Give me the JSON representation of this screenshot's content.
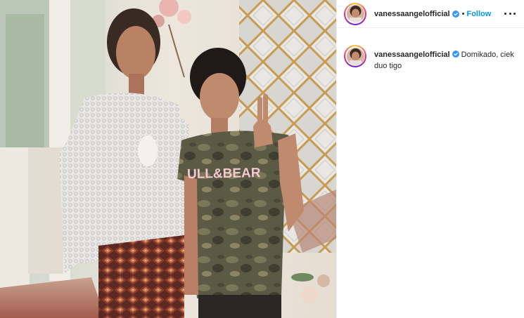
{
  "post": {
    "photo": {
      "subject": "two-women-photo",
      "shirt_print": "ULL&BEAR"
    },
    "header": {
      "username": "vanessaangelofficial",
      "separator": "•",
      "follow_label": "Follow",
      "verified_icon": "verified-badge-icon",
      "more_icon": "more-options-icon"
    },
    "caption": {
      "username": "vanessaangelofficial",
      "text": "Domikado, ciek duo tigo"
    },
    "colors": {
      "accent": "#0095f6",
      "verified": "#3897f0",
      "text": "#262626",
      "divider": "#efefef"
    }
  }
}
